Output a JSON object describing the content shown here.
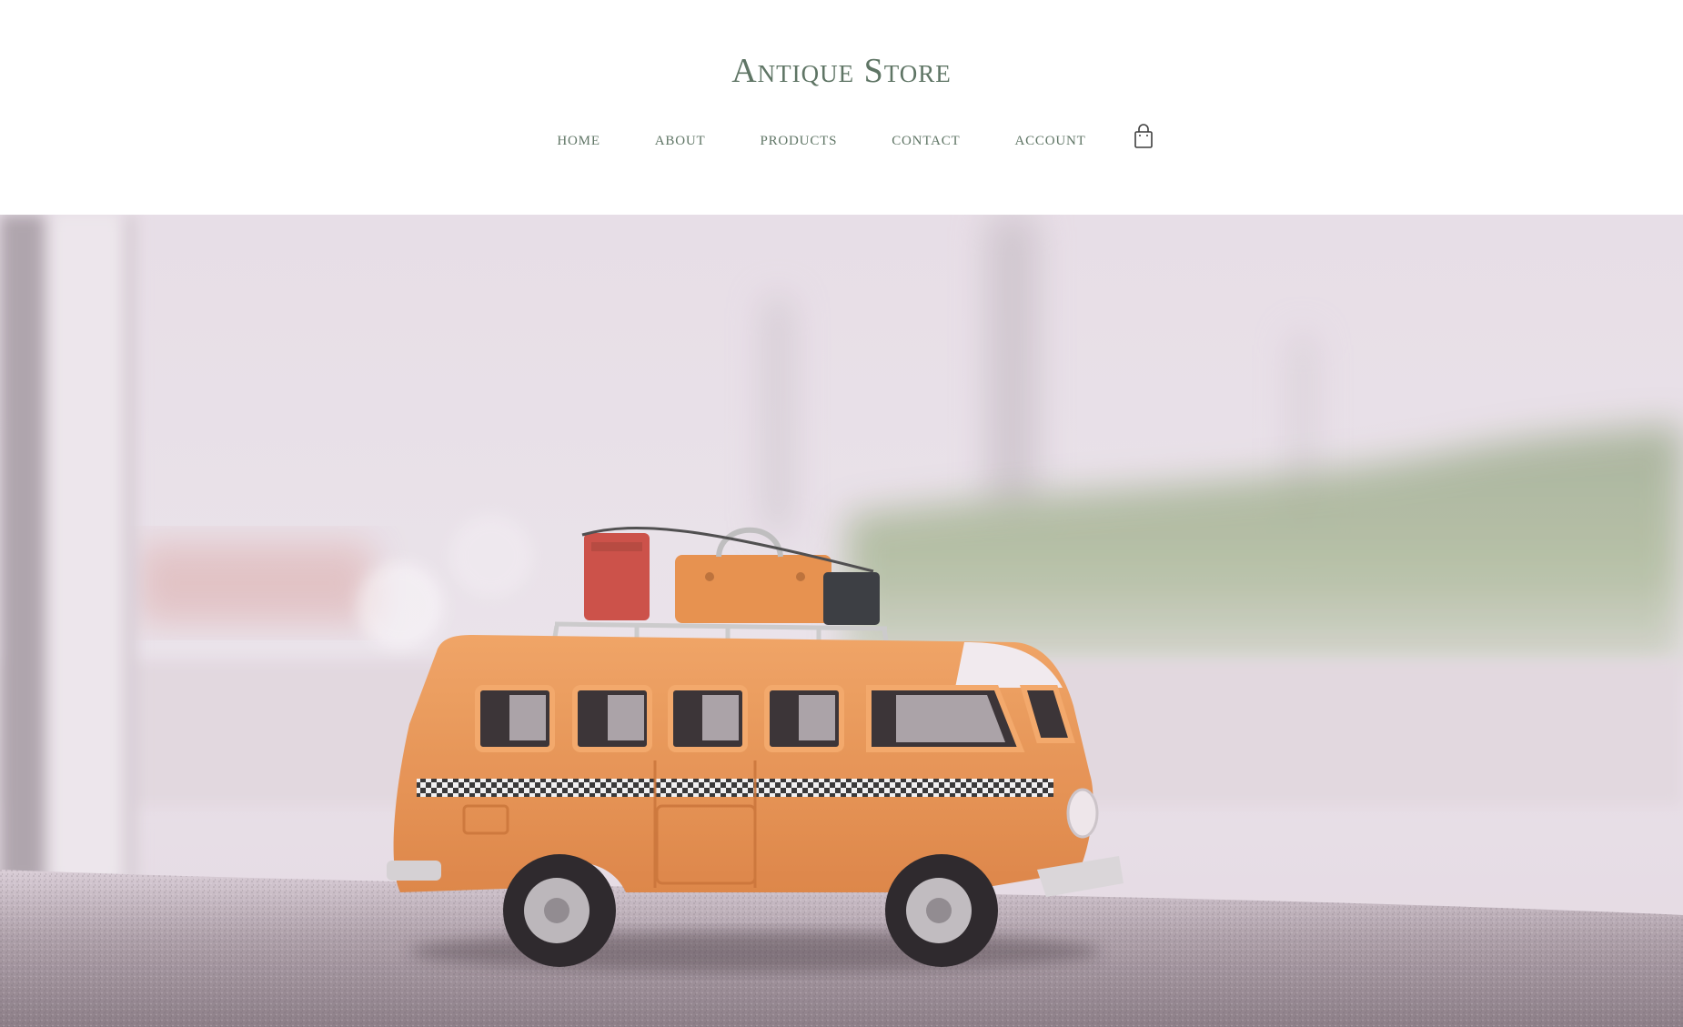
{
  "site": {
    "title": "Antique Store"
  },
  "nav": {
    "items": [
      {
        "label": "HOME"
      },
      {
        "label": "ABOUT"
      },
      {
        "label": "PRODUCTS"
      },
      {
        "label": "CONTACT"
      },
      {
        "label": "ACCOUNT"
      }
    ],
    "cart_icon": "shopping-bag-icon"
  },
  "hero": {
    "image": "vintage-orange-toy-bus-photo"
  },
  "colors": {
    "accent": "#5f7565",
    "background": "#ffffff",
    "bus_orange": "#e58a45"
  }
}
